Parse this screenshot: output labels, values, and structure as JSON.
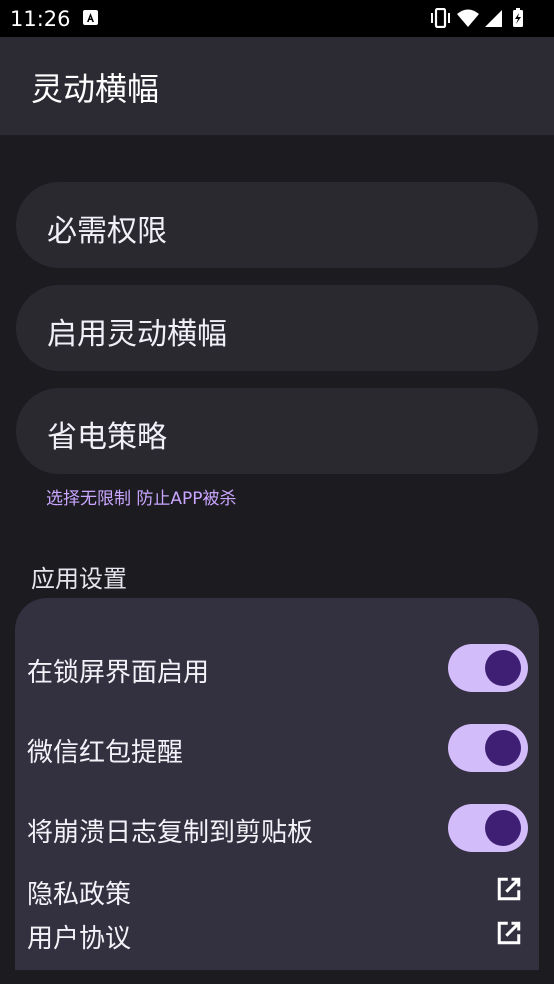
{
  "status_bar": {
    "time": "11:26",
    "icons": [
      "app-notification-icon",
      "vibrate-icon",
      "wifi-icon",
      "cellular-icon",
      "battery-charging-icon"
    ]
  },
  "app_bar": {
    "title": "灵动横幅"
  },
  "cards": [
    {
      "label": "必需权限"
    },
    {
      "label": "启用灵动横幅"
    },
    {
      "label": "省电策略"
    }
  ],
  "power_hint": "选择无限制 防止APP被杀",
  "section": {
    "title": "应用设置"
  },
  "settings": {
    "toggles": [
      {
        "label": "在锁屏界面启用",
        "on": true
      },
      {
        "label": "微信红包提醒",
        "on": true
      },
      {
        "label": "将崩溃日志复制到剪贴板",
        "on": true
      }
    ],
    "links": [
      {
        "label": "隐私政策",
        "icon": "open-external-icon"
      },
      {
        "label": "用户协议",
        "icon": "open-external-icon"
      }
    ]
  },
  "colors": {
    "background": "#1c1b20",
    "app_bar": "#2c2b33",
    "card": "#2a2930",
    "panel": "#33303f",
    "accent_text": "#c9a6ff",
    "toggle_track": "#d2bcfa",
    "toggle_knob": "#3f1f73"
  }
}
